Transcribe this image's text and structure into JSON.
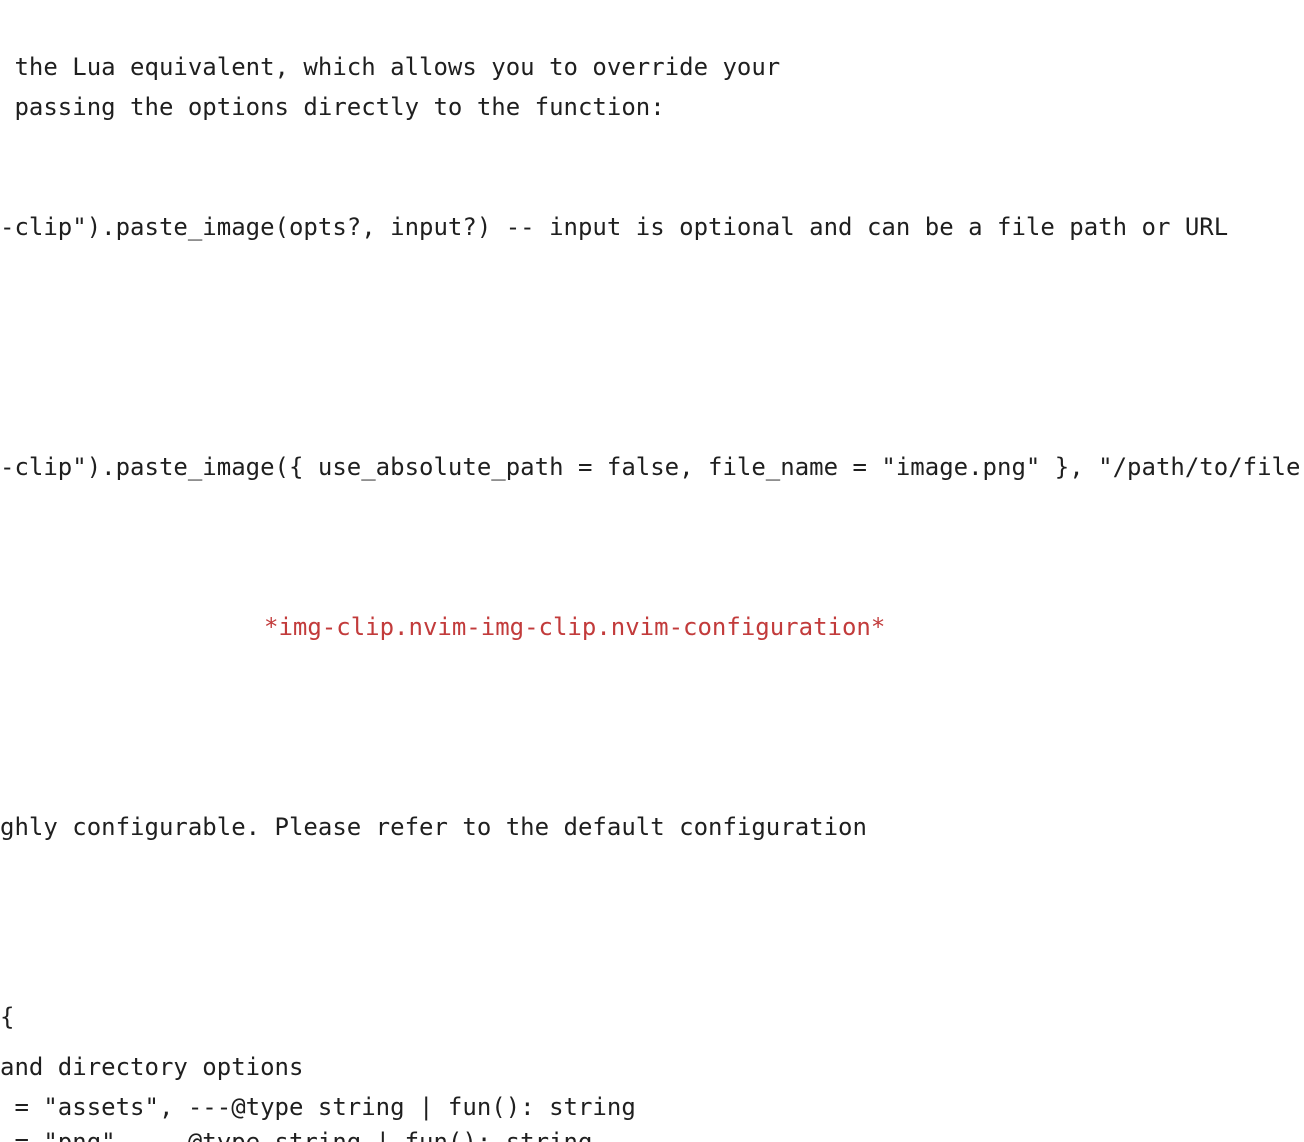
{
  "doc": {
    "lines": [
      " the Lua equivalent, which allows you to override your",
      " passing the options directly to the function:",
      "-clip\").paste_image(opts?, input?) -- input is optional and can be a file path or URL",
      "-clip\").paste_image({ use_absolute_path = false, file_name = \"image.png\" }, \"/path/to/file.",
      "*img-clip.nvim-img-clip.nvim-configuration*",
      "ghly configurable. Please refer to the default configuration",
      "{",
      "and directory options",
      " = \"assets\", ---@type string | fun(): string",
      " = \"png\", ---@type string | fun(): string"
    ]
  }
}
